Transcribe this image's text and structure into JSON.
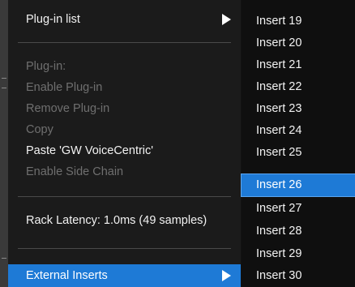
{
  "main_menu": {
    "plugin_list": "Plug-in list",
    "plugin": "Plug-in:",
    "enable_plugin": "Enable Plug-in",
    "remove_plugin": "Remove Plug-in",
    "copy": "Copy",
    "paste": "Paste 'GW VoiceCentric'",
    "enable_side_chain": "Enable Side Chain",
    "rack_latency": "Rack Latency: 1.0ms (49 samples)",
    "external_inserts": "External Inserts"
  },
  "submenu": {
    "items": [
      "Insert 19",
      "Insert 20",
      "Insert 21",
      "Insert 22",
      "Insert 23",
      "Insert 24",
      "Insert 25",
      "Insert 26",
      "Insert 27",
      "Insert 28",
      "Insert 29",
      "Insert 30"
    ],
    "selected": "Insert 26"
  },
  "colors": {
    "highlight": "#1e7ad6",
    "menu_bg": "#1b1b1b",
    "submenu_bg": "#0f0f0f",
    "text_enabled": "#f2f2f2",
    "text_disabled": "#6f6f6f"
  },
  "icons": {
    "submenu_arrow": "triangle-right-icon"
  }
}
